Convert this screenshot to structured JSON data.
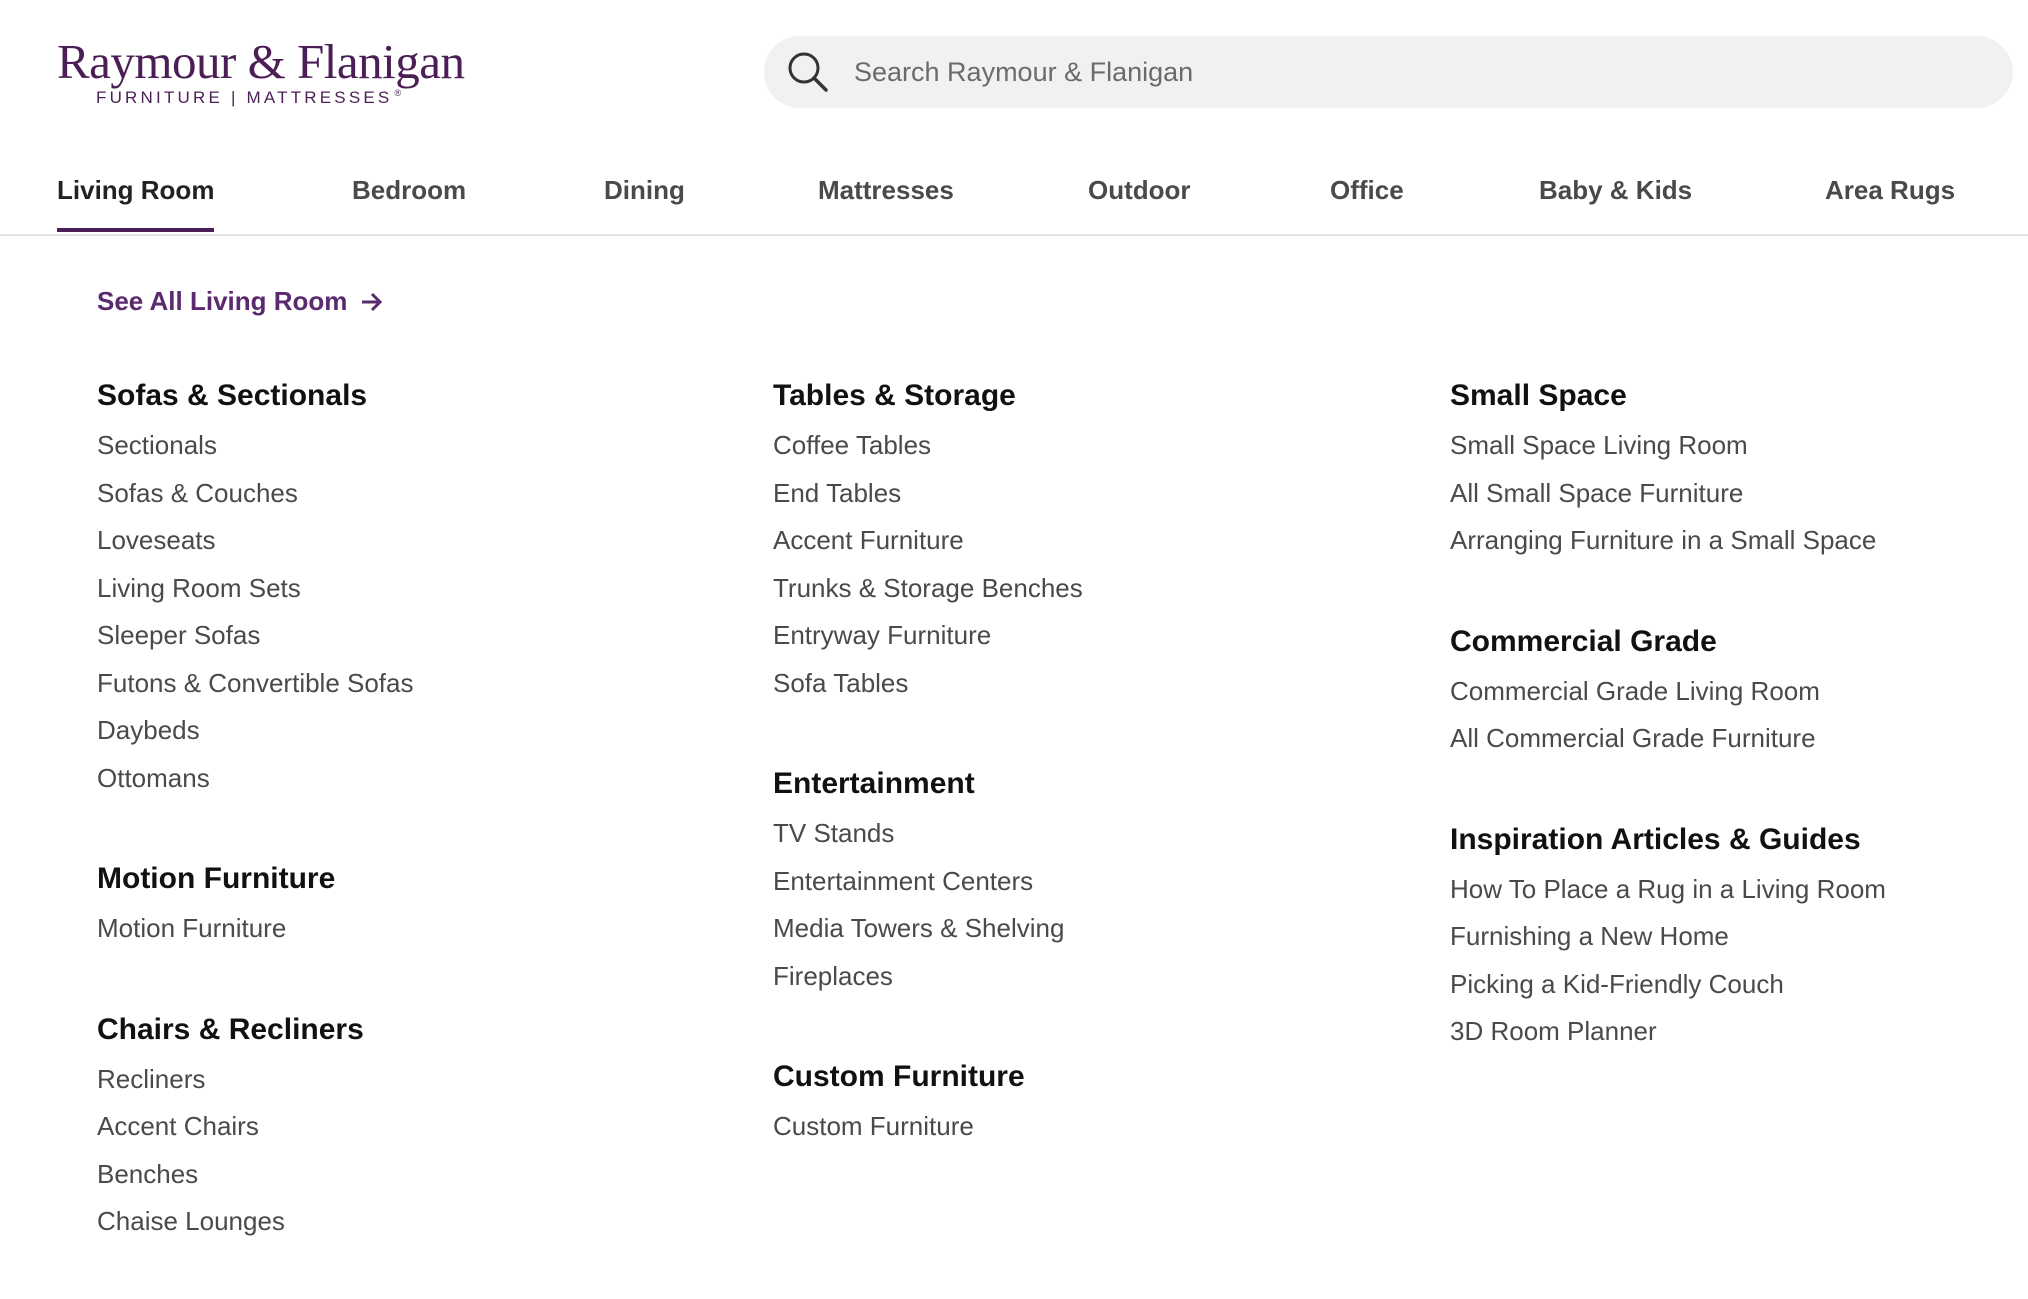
{
  "brand": {
    "name": "Raymour & Flanigan",
    "tagline": "FURNITURE | MATTRESSES",
    "registered": "®",
    "color": "#4b1f55"
  },
  "search": {
    "placeholder": "Search Raymour & Flanigan",
    "icon": "search-icon"
  },
  "nav": {
    "tabs": [
      {
        "label": "Living Room",
        "active": true
      },
      {
        "label": "Bedroom"
      },
      {
        "label": "Dining"
      },
      {
        "label": "Mattresses"
      },
      {
        "label": "Outdoor"
      },
      {
        "label": "Office"
      },
      {
        "label": "Baby & Kids"
      },
      {
        "label": "Area Rugs"
      }
    ]
  },
  "menu": {
    "see_all": "See All Living Room",
    "see_all_icon": "arrow-right-icon",
    "columns": [
      [
        {
          "title": "Sofas & Sectionals",
          "links": [
            "Sectionals",
            "Sofas & Couches",
            "Loveseats",
            "Living Room Sets",
            "Sleeper Sofas",
            "Futons & Convertible Sofas",
            "Daybeds",
            "Ottomans"
          ]
        },
        {
          "title": "Motion Furniture",
          "links": [
            "Motion Furniture"
          ]
        },
        {
          "title": "Chairs & Recliners",
          "links": [
            "Recliners",
            "Accent Chairs",
            "Benches",
            "Chaise Lounges"
          ]
        }
      ],
      [
        {
          "title": "Tables & Storage",
          "links": [
            "Coffee Tables",
            "End Tables",
            "Accent Furniture",
            "Trunks & Storage Benches",
            "Entryway Furniture",
            "Sofa Tables"
          ]
        },
        {
          "title": "Entertainment",
          "links": [
            "TV Stands",
            "Entertainment Centers",
            "Media Towers & Shelving",
            "Fireplaces"
          ]
        },
        {
          "title": "Custom Furniture",
          "links": [
            "Custom Furniture"
          ]
        }
      ],
      [
        {
          "title": "Small Space",
          "links": [
            "Small Space Living Room",
            "All Small Space Furniture",
            "Arranging Furniture in a Small Space"
          ]
        },
        {
          "title": "Commercial Grade",
          "links": [
            "Commercial Grade Living Room",
            "All Commercial Grade Furniture"
          ]
        },
        {
          "title": "Inspiration Articles & Guides",
          "links": [
            "How To Place a Rug in a Living Room",
            "Furnishing a New Home",
            "Picking a Kid-Friendly Couch",
            "3D Room Planner"
          ]
        }
      ]
    ]
  }
}
